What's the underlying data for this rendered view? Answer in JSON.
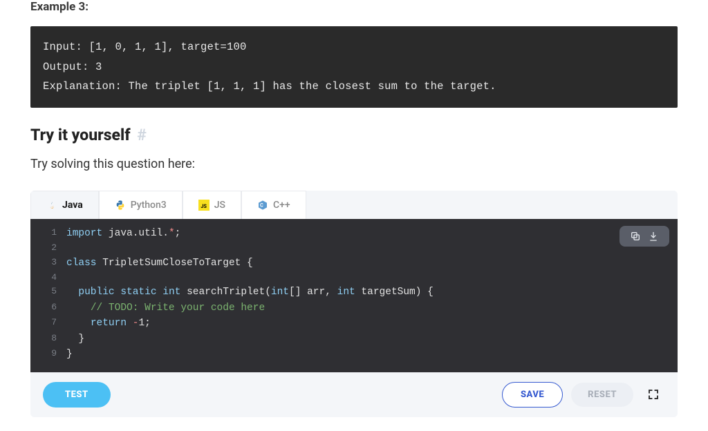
{
  "example": {
    "label": "Example 3:",
    "code": "Input: [1, 0, 1, 1], target=100\nOutput: 3\nExplanation: The triplet [1, 1, 1] has the closest sum to the target."
  },
  "heading": {
    "title": "Try it yourself",
    "anchor": "#"
  },
  "instruction": "Try solving this question here:",
  "tabs": [
    {
      "label": "Java",
      "icon": "java-icon",
      "active": true
    },
    {
      "label": "Python3",
      "icon": "python-icon",
      "active": false
    },
    {
      "label": "JS",
      "icon": "js-icon",
      "active": false
    },
    {
      "label": "C++",
      "icon": "cpp-icon",
      "active": false
    }
  ],
  "editor_lines": [
    {
      "n": 1,
      "tokens": [
        [
          "keyword",
          "import"
        ],
        [
          "punct",
          " "
        ],
        [
          "pkg",
          "java.util."
        ],
        [
          "op",
          "*"
        ],
        [
          "punct",
          ";"
        ]
      ]
    },
    {
      "n": 2,
      "tokens": []
    },
    {
      "n": 3,
      "tokens": [
        [
          "keyword",
          "class"
        ],
        [
          "punct",
          " "
        ],
        [
          "class",
          "TripletSumCloseToTarget"
        ],
        [
          "punct",
          " {"
        ]
      ]
    },
    {
      "n": 4,
      "tokens": []
    },
    {
      "n": 5,
      "tokens": [
        [
          "punct",
          "  "
        ],
        [
          "keyword",
          "public"
        ],
        [
          "punct",
          " "
        ],
        [
          "keyword",
          "static"
        ],
        [
          "punct",
          " "
        ],
        [
          "type",
          "int"
        ],
        [
          "punct",
          " "
        ],
        [
          "func",
          "searchTriplet"
        ],
        [
          "punct",
          "("
        ],
        [
          "type",
          "int"
        ],
        [
          "punct",
          "[] arr, "
        ],
        [
          "type",
          "int"
        ],
        [
          "punct",
          " targetSum) {"
        ]
      ]
    },
    {
      "n": 6,
      "tokens": [
        [
          "punct",
          "    "
        ],
        [
          "comment",
          "// TODO: Write your code here"
        ]
      ]
    },
    {
      "n": 7,
      "tokens": [
        [
          "punct",
          "    "
        ],
        [
          "keyword",
          "return"
        ],
        [
          "punct",
          " "
        ],
        [
          "op",
          "-"
        ],
        [
          "num",
          "1"
        ],
        [
          "punct",
          ";"
        ]
      ]
    },
    {
      "n": 8,
      "tokens": [
        [
          "punct",
          "  }"
        ]
      ]
    },
    {
      "n": 9,
      "tokens": [
        [
          "punct",
          "}"
        ]
      ]
    }
  ],
  "buttons": {
    "test": "TEST",
    "save": "SAVE",
    "reset": "RESET"
  }
}
